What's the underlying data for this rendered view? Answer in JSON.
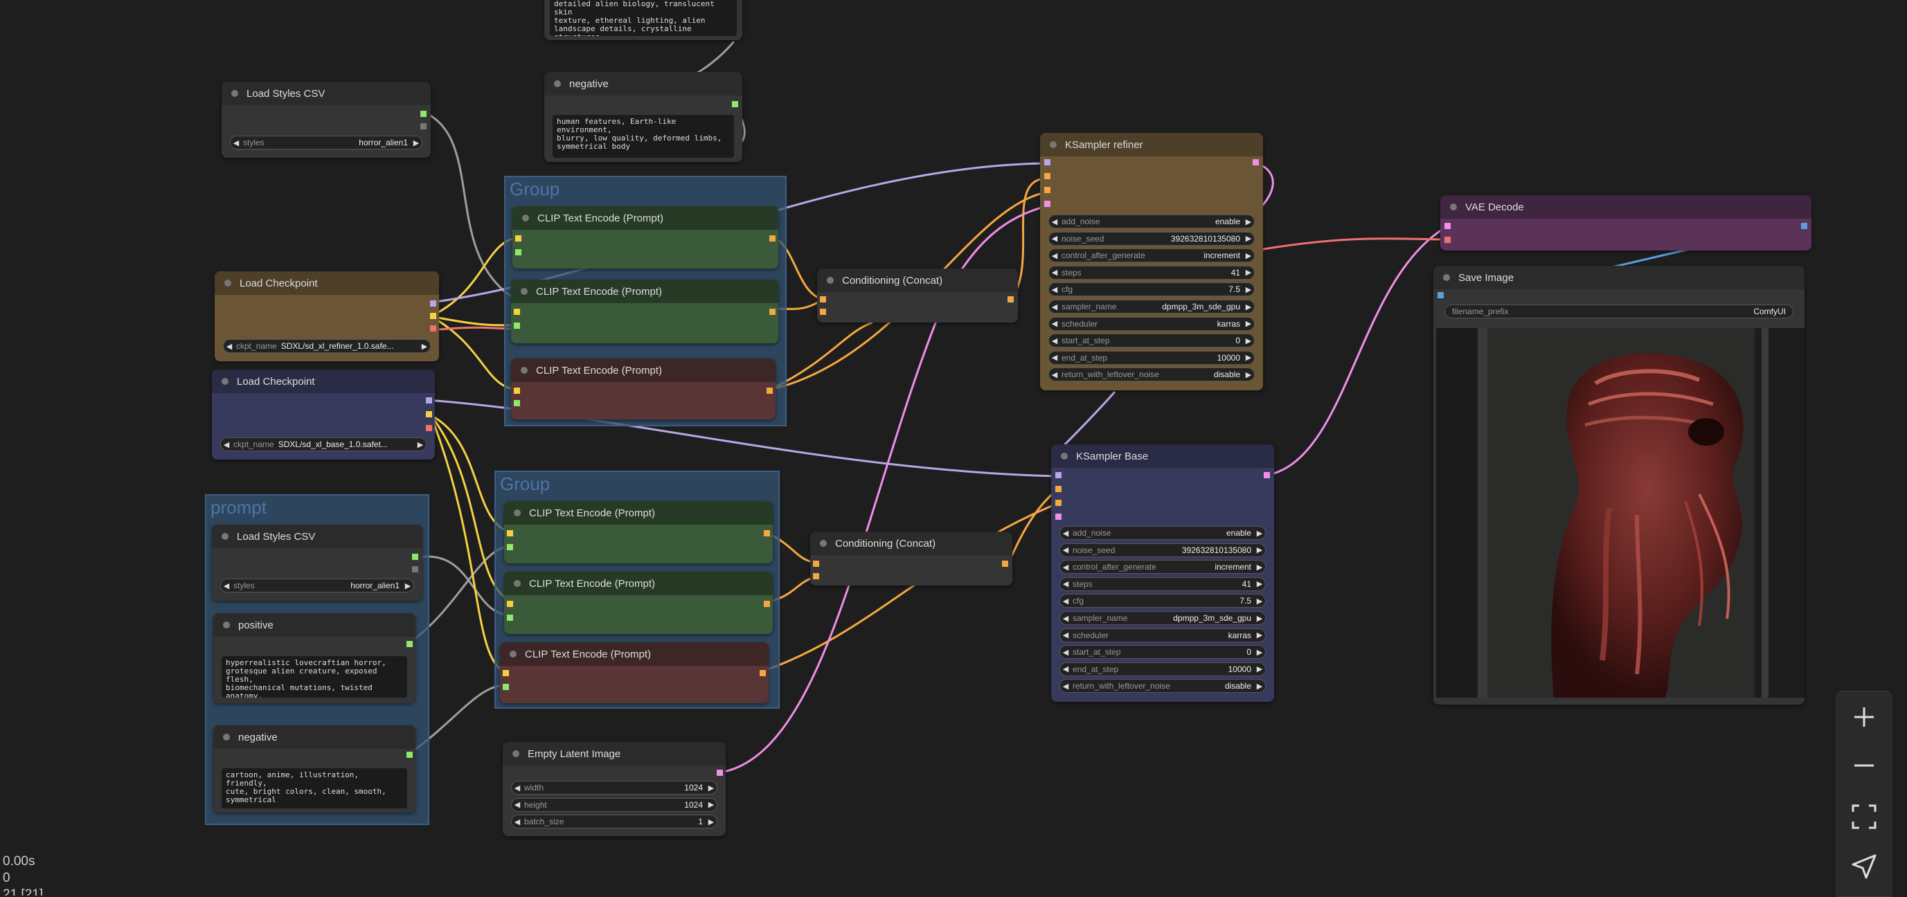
{
  "colors": {
    "background": "#1e1e1e",
    "group": "#345473",
    "clip_positive": "#3a5a3a",
    "clip_negative": "#5a3535",
    "checkpoint": "#6a5634",
    "sampler_base": "#373a5c",
    "sampler_refiner": "#6a5634",
    "vae_decode": "#5b3258",
    "wire_clip": "#f5d142",
    "wire_conditioning": "#f5a742",
    "wire_model": "#b9a6e8",
    "wire_latent": "#f08ee8",
    "wire_vae": "#f07070",
    "wire_image": "#5aa0e0",
    "wire_string": "#9aa09a"
  },
  "top_prompt": {
    "text": "detailed alien biology, translucent skin\ntexture, ethereal lighting, alien\nlandscape details, crystalline structures,\natmospheric fog, sharp details"
  },
  "negative_top": {
    "title": "negative",
    "text": "human features, Earth-like environment,\nblurry, low quality, deformed limbs,\nsymmetrical body"
  },
  "load_styles_top": {
    "title": "Load Styles CSV",
    "widget_label": "styles",
    "widget_value": "horror_alien1"
  },
  "group_top": {
    "title": "Group"
  },
  "group_bottom": {
    "title": "Group"
  },
  "clip_top_1": {
    "title": "CLIP Text Encode (Prompt)"
  },
  "clip_top_2": {
    "title": "CLIP Text Encode (Prompt)"
  },
  "clip_top_3": {
    "title": "CLIP Text Encode (Prompt)"
  },
  "clip_bottom_1": {
    "title": "CLIP Text Encode (Prompt)"
  },
  "clip_bottom_2": {
    "title": "CLIP Text Encode (Prompt)"
  },
  "clip_bottom_3": {
    "title": "CLIP Text Encode (Prompt)"
  },
  "load_checkpoint_refiner": {
    "title": "Load Checkpoint",
    "widget_label": "ckpt_name",
    "widget_value": "SDXL/sd_xl_refiner_1.0.safe..."
  },
  "load_checkpoint_base": {
    "title": "Load Checkpoint",
    "widget_label": "ckpt_name",
    "widget_value": "SDXL/sd_xl_base_1.0.safet..."
  },
  "cond_concat_top": {
    "title": "Conditioning (Concat)"
  },
  "cond_concat_bottom": {
    "title": "Conditioning (Concat)"
  },
  "ksampler_refiner": {
    "title": "KSampler  refiner",
    "widgets": [
      {
        "label": "add_noise",
        "value": "enable"
      },
      {
        "label": "noise_seed",
        "value": "392632810135080"
      },
      {
        "label": "control_after_generate",
        "value": "increment"
      },
      {
        "label": "steps",
        "value": "41"
      },
      {
        "label": "cfg",
        "value": "7.5"
      },
      {
        "label": "sampler_name",
        "value": "dpmpp_3m_sde_gpu"
      },
      {
        "label": "scheduler",
        "value": "karras"
      },
      {
        "label": "start_at_step",
        "value": "0"
      },
      {
        "label": "end_at_step",
        "value": "10000"
      },
      {
        "label": "return_with_leftover_noise",
        "value": "disable"
      }
    ]
  },
  "ksampler_base": {
    "title": "KSampler  Base",
    "widgets": [
      {
        "label": "add_noise",
        "value": "enable"
      },
      {
        "label": "noise_seed",
        "value": "392632810135080"
      },
      {
        "label": "control_after_generate",
        "value": "increment"
      },
      {
        "label": "steps",
        "value": "41"
      },
      {
        "label": "cfg",
        "value": "7.5"
      },
      {
        "label": "sampler_name",
        "value": "dpmpp_3m_sde_gpu"
      },
      {
        "label": "scheduler",
        "value": "karras"
      },
      {
        "label": "start_at_step",
        "value": "0"
      },
      {
        "label": "end_at_step",
        "value": "10000"
      },
      {
        "label": "return_with_leftover_noise",
        "value": "disable"
      }
    ]
  },
  "vae_decode": {
    "title": "VAE Decode"
  },
  "save_image": {
    "title": "Save Image",
    "widget_label": "filename_prefix",
    "widget_value": "ComfyUI"
  },
  "prompt_group": {
    "title": "prompt",
    "load_styles": {
      "title": "Load Styles CSV",
      "widget_label": "styles",
      "widget_value": "horror_alien1"
    },
    "positive": {
      "title": "positive",
      "text": "hyperrealistic lovecraftian horror,\ngrotesque alien creature, exposed flesh,\nbiomechanical mutations, twisted anatomy,\ndripping acidic secretions, barren alien\nwasteland, blood-red sky, dark bizarre"
    },
    "negative": {
      "title": "negative",
      "text": "cartoon, anime, illustration, friendly,\ncute, bright colors, clean, smooth,\nsymmetrical"
    }
  },
  "empty_latent": {
    "title": "Empty Latent Image",
    "widgets": [
      {
        "label": "width",
        "value": "1024"
      },
      {
        "label": "height",
        "value": "1024"
      },
      {
        "label": "batch_size",
        "value": "1"
      }
    ]
  },
  "stats": {
    "time": "0.00s",
    "count": "0",
    "extra": "21 [21]"
  },
  "icons": {
    "zoom_in": "plus-icon",
    "zoom_out": "minus-icon",
    "fit": "fit-view-icon",
    "locate": "send-icon"
  }
}
